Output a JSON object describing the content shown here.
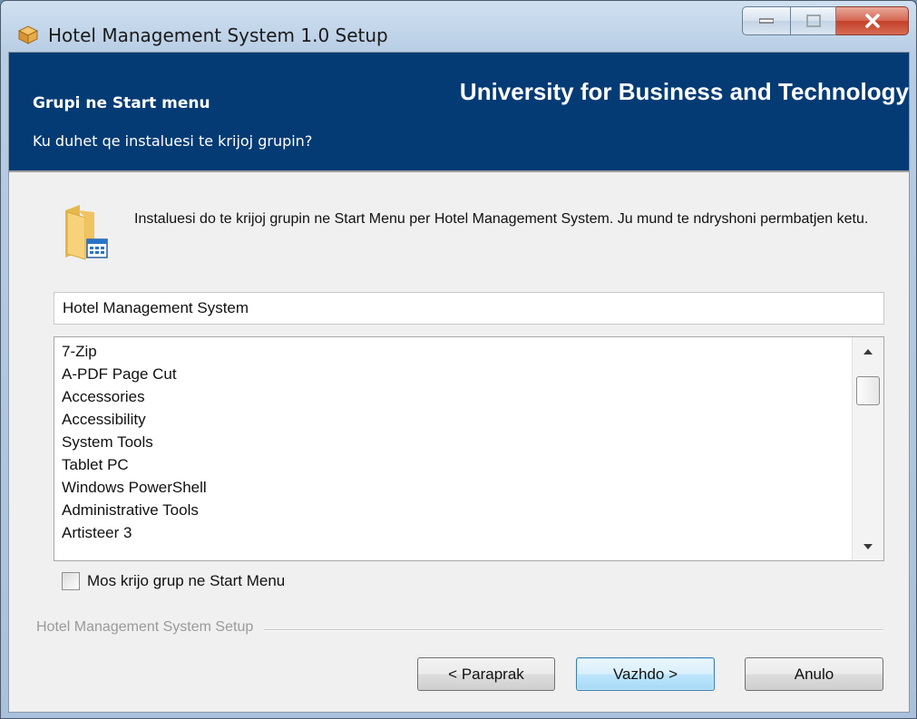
{
  "window": {
    "title": "Hotel Management System 1.0 Setup"
  },
  "header": {
    "title": "Grupi ne Start menu",
    "subtitle": "Ku duhet qe instaluesi te krijoj grupin?",
    "brand": "University for Business and Technology"
  },
  "body": {
    "description": "Instaluesi do te krijoj grupin ne Start Menu per Hotel Management System. Ju mund te ndryshoni permbatjen ketu.",
    "group_name_value": "Hotel Management System",
    "folders": [
      "7-Zip",
      "A-PDF Page Cut",
      "Accessories",
      "Accessibility",
      "System Tools",
      "Tablet PC",
      "Windows PowerShell",
      "Administrative Tools",
      "Artisteer 3"
    ],
    "no_group_checkbox_label": "Mos krijo grup ne Start Menu",
    "no_group_checked": false
  },
  "footer": {
    "branding": "Hotel Management System Setup",
    "back_label": "< Paraprak",
    "next_label": "Vazhdo >",
    "cancel_label": "Anulo"
  },
  "icons": {
    "title_icon": "installer-box-icon",
    "header_folder_icon": "start-menu-folder-icon"
  },
  "colors": {
    "header_band": "#053b74",
    "close_button": "#c4402a"
  }
}
